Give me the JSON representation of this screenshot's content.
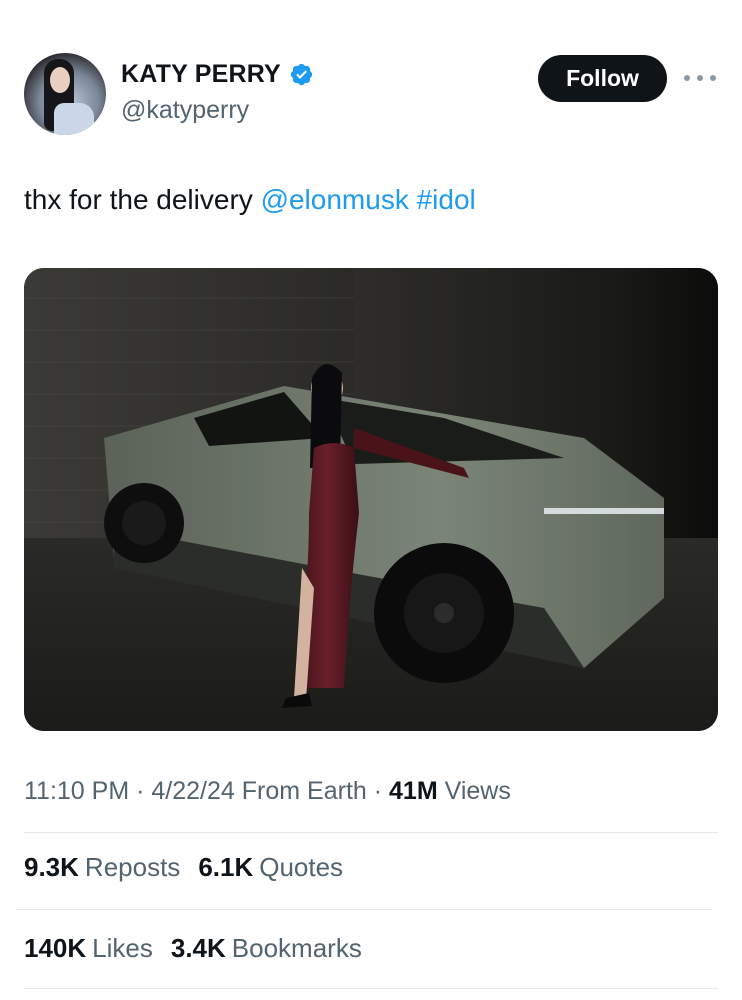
{
  "author": {
    "display_name": "KATY PERRY",
    "handle": "@katyperry",
    "verified": true
  },
  "header": {
    "follow_label": "Follow"
  },
  "tweet": {
    "text_plain": "thx for the delivery",
    "mention": "@elonmusk",
    "hashtag": "#idol"
  },
  "meta": {
    "time": "11:10 PM",
    "sep1": "·",
    "date": "4/22/24",
    "source": "From Earth",
    "sep2": "·",
    "views_count": "41M",
    "views_label": "Views"
  },
  "stats": {
    "reposts_count": "9.3K",
    "reposts_label": "Reposts",
    "quotes_count": "6.1K",
    "quotes_label": "Quotes",
    "likes_count": "140K",
    "likes_label": "Likes",
    "bookmarks_count": "3.4K",
    "bookmarks_label": "Bookmarks"
  },
  "colors": {
    "link": "#1d9bf0",
    "verified": "#1d9bf0",
    "follow_bg": "#0f1419",
    "muted_text": "#536471"
  },
  "icons": [
    "verified-badge-icon",
    "more-options-icon"
  ]
}
